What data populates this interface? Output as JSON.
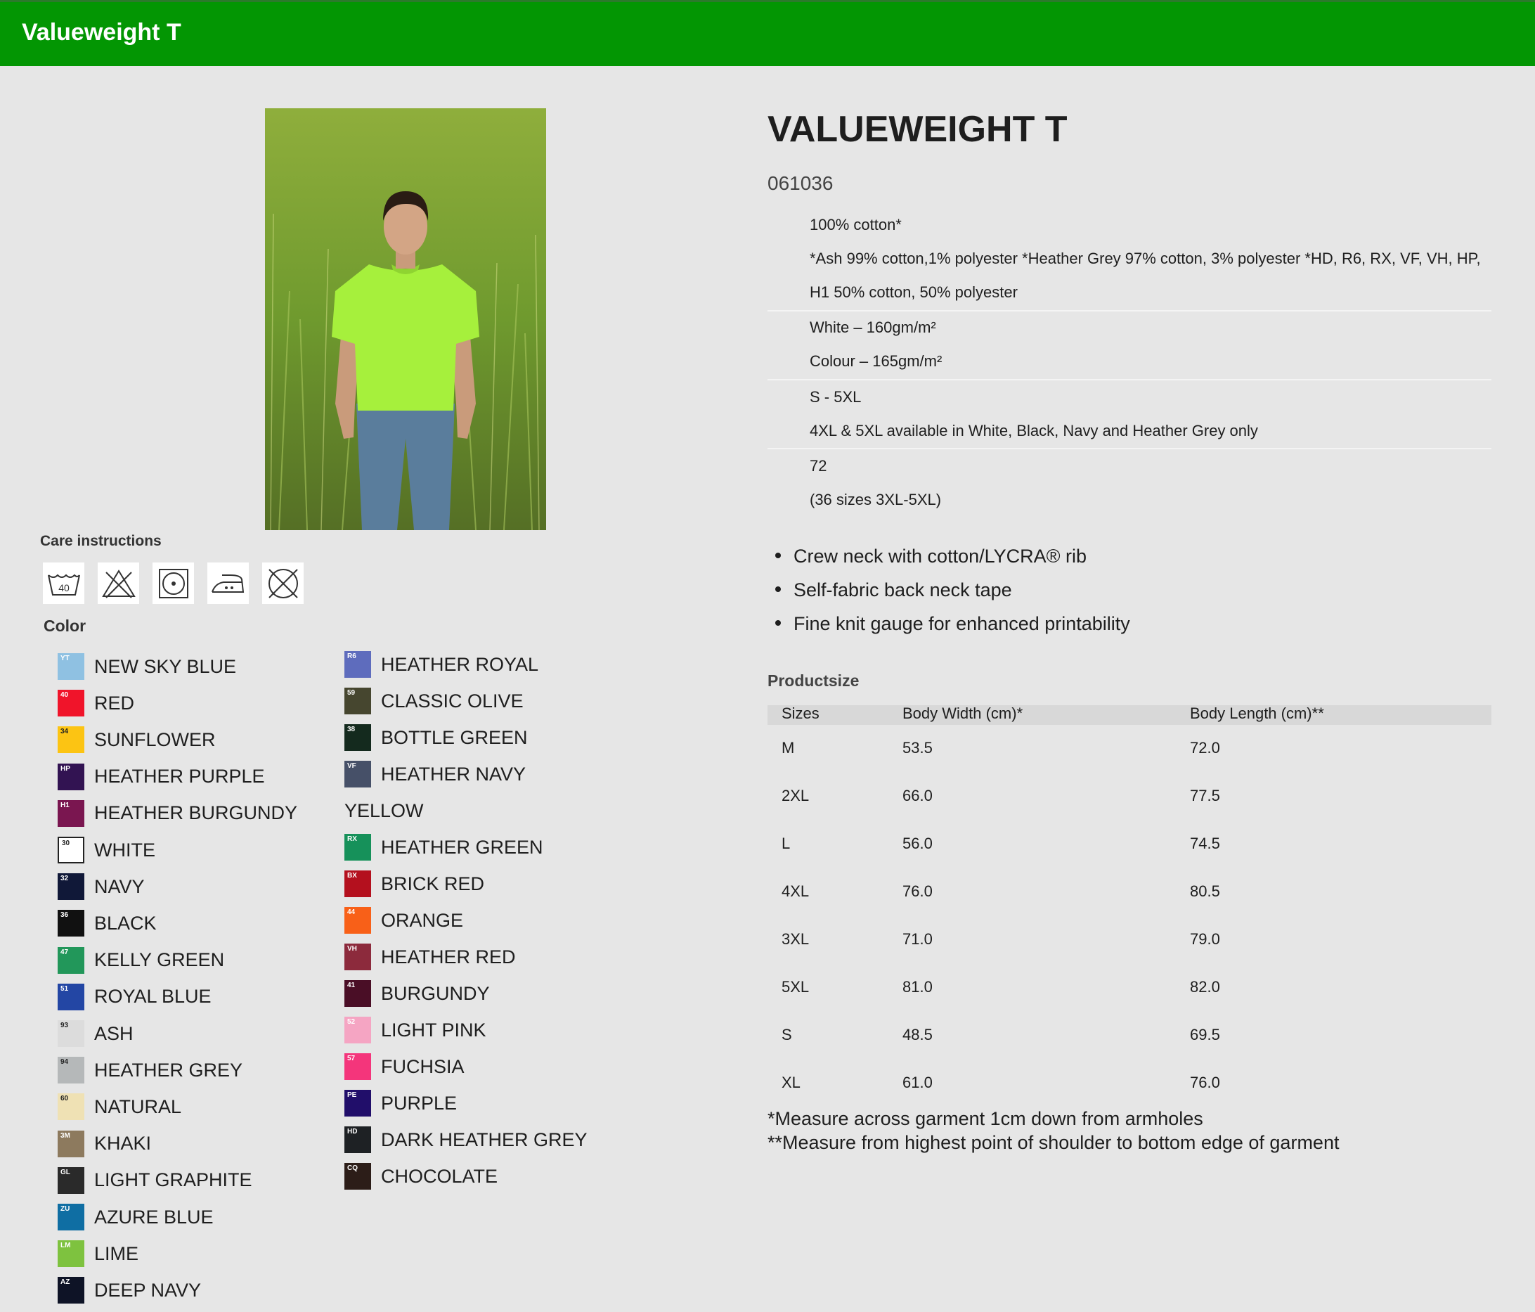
{
  "header": {
    "title": "Valueweight T"
  },
  "product": {
    "name": "VALUEWEIGHT T",
    "code": "061036",
    "photo_alt": "Man wearing lime t-shirt in a grass field"
  },
  "specs": {
    "material": [
      "100% cotton*",
      "*Ash 99% cotton,1% polyester *Heather Grey 97% cotton, 3% polyester *HD, R6, RX, VF, VH, HP,",
      "H1 50% cotton, 50% polyester"
    ],
    "weight": [
      "White – 160gm/m²",
      "Colour – 165gm/m²"
    ],
    "sizes": [
      "S - 5XL",
      "4XL & 5XL available in White, Black, Navy and Heather Grey only"
    ],
    "pack": [
      "72",
      "(36 sizes 3XL-5XL)"
    ]
  },
  "features": [
    "Crew neck with cotton/LYCRA® rib",
    "Self-fabric back neck tape",
    "Fine knit gauge for enhanced printability"
  ],
  "care": {
    "title": "Care instructions",
    "icons": [
      {
        "name": "wash-40-icon",
        "label": "40"
      },
      {
        "name": "no-bleach-icon"
      },
      {
        "name": "tumble-dry-icon"
      },
      {
        "name": "iron-medium-icon"
      },
      {
        "name": "no-dry-clean-icon"
      }
    ]
  },
  "colors": {
    "title": "Color",
    "left": [
      {
        "code": "YT",
        "name": "NEW SKY BLUE",
        "hex": "#8fc1e2",
        "codeColor": "#ffffff"
      },
      {
        "code": "40",
        "name": "RED",
        "hex": "#f0142a",
        "codeColor": "#ffffff"
      },
      {
        "code": "34",
        "name": "SUNFLOWER",
        "hex": "#fcc413",
        "codeColor": "#222222"
      },
      {
        "code": "HP",
        "name": "HEATHER PURPLE",
        "hex": "#321352",
        "codeColor": "#ffffff"
      },
      {
        "code": "H1",
        "name": "HEATHER BURGUNDY",
        "hex": "#7a1650",
        "codeColor": "#ffffff"
      },
      {
        "code": "30",
        "name": "WHITE",
        "hex": "#ffffff",
        "codeColor": "#222222"
      },
      {
        "code": "32",
        "name": "NAVY",
        "hex": "#101838",
        "codeColor": "#ffffff"
      },
      {
        "code": "36",
        "name": "BLACK",
        "hex": "#111111",
        "codeColor": "#ffffff"
      },
      {
        "code": "47",
        "name": "KELLY GREEN",
        "hex": "#22975a",
        "codeColor": "#ffffff"
      },
      {
        "code": "51",
        "name": "ROYAL BLUE",
        "hex": "#2346a4",
        "codeColor": "#ffffff"
      },
      {
        "code": "93",
        "name": "ASH",
        "hex": "#dcdcdc",
        "codeColor": "#222222"
      },
      {
        "code": "94",
        "name": "HEATHER GREY",
        "hex": "#b5b8b9",
        "codeColor": "#222222"
      },
      {
        "code": "60",
        "name": "NATURAL",
        "hex": "#efe1b4",
        "codeColor": "#222222"
      },
      {
        "code": "3M",
        "name": "KHAKI",
        "hex": "#8d7a5e",
        "codeColor": "#ffffff"
      },
      {
        "code": "GL",
        "name": "LIGHT GRAPHITE",
        "hex": "#2a2a2a",
        "codeColor": "#ffffff"
      },
      {
        "code": "ZU",
        "name": "AZURE BLUE",
        "hex": "#0f6ea3",
        "codeColor": "#ffffff"
      },
      {
        "code": "LM",
        "name": "LIME",
        "hex": "#7ec23f",
        "codeColor": "#ffffff"
      },
      {
        "code": "AZ",
        "name": "DEEP NAVY",
        "hex": "#0e1326",
        "codeColor": "#ffffff"
      }
    ],
    "right": [
      {
        "code": "R6",
        "name": "HEATHER ROYAL",
        "hex": "#5e6cbd",
        "codeColor": "#ffffff"
      },
      {
        "code": "59",
        "name": "CLASSIC OLIVE",
        "hex": "#46462f",
        "codeColor": "#ffffff"
      },
      {
        "code": "38",
        "name": "BOTTLE GREEN",
        "hex": "#142a1e",
        "codeColor": "#ffffff"
      },
      {
        "code": "VF",
        "name": "HEATHER NAVY",
        "hex": "#465068",
        "codeColor": "#ffffff"
      },
      {
        "code": "",
        "name": "YELLOW",
        "hex": "",
        "codeColor": ""
      },
      {
        "code": "RX",
        "name": "HEATHER GREEN",
        "hex": "#16915a",
        "codeColor": "#ffffff"
      },
      {
        "code": "BX",
        "name": "BRICK RED",
        "hex": "#b4101e",
        "codeColor": "#ffffff"
      },
      {
        "code": "44",
        "name": "ORANGE",
        "hex": "#f86018",
        "codeColor": "#ffffff"
      },
      {
        "code": "VH",
        "name": "HEATHER RED",
        "hex": "#8c2a3c",
        "codeColor": "#ffffff"
      },
      {
        "code": "41",
        "name": "BURGUNDY",
        "hex": "#4a0e26",
        "codeColor": "#ffffff"
      },
      {
        "code": "52",
        "name": "LIGHT PINK",
        "hex": "#f5a5c3",
        "codeColor": "#ffffff"
      },
      {
        "code": "57",
        "name": "FUCHSIA",
        "hex": "#f4357b",
        "codeColor": "#ffffff"
      },
      {
        "code": "PE",
        "name": "PURPLE",
        "hex": "#210e6a",
        "codeColor": "#ffffff"
      },
      {
        "code": "HD",
        "name": "DARK HEATHER GREY",
        "hex": "#1e2124",
        "codeColor": "#ffffff"
      },
      {
        "code": "CQ",
        "name": "CHOCOLATE",
        "hex": "#2c1d18",
        "codeColor": "#ffffff"
      }
    ]
  },
  "productsize": {
    "title": "Productsize",
    "headers": [
      "Sizes",
      "Body Width (cm)*",
      "Body Length (cm)**"
    ],
    "rows": [
      [
        "M",
        "53.5",
        "72.0"
      ],
      [
        "2XL",
        "66.0",
        "77.5"
      ],
      [
        "L",
        "56.0",
        "74.5"
      ],
      [
        "4XL",
        "76.0",
        "80.5"
      ],
      [
        "3XL",
        "71.0",
        "79.0"
      ],
      [
        "5XL",
        "81.0",
        "82.0"
      ],
      [
        "S",
        "48.5",
        "69.5"
      ],
      [
        "XL",
        "61.0",
        "76.0"
      ]
    ],
    "footnotes": [
      "*Measure across garment 1cm down from armholes",
      "**Measure from highest point of shoulder to bottom edge of garment"
    ]
  }
}
